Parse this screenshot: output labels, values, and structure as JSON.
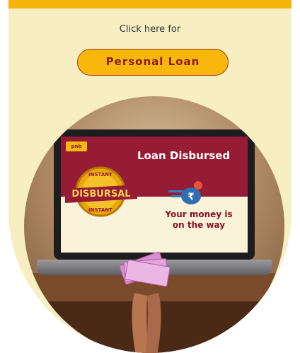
{
  "header": {
    "prompt": "Click here for"
  },
  "cta": {
    "label": "Personal Loan"
  },
  "banner": {
    "brand_badge": "pnb",
    "title": "Loan Disbursed",
    "subtitle_line1": "Your money is",
    "subtitle_line2": "on the way",
    "seal_top": "INSTANT",
    "seal_middle": "DISBURSAL",
    "seal_bottom": "INSTANT",
    "currency_symbol": "₹"
  },
  "colors": {
    "accent": "#f5b40a",
    "panel_background": "#f7efc2",
    "brand_maroon": "#961b35"
  },
  "icons": [
    "rupee-money-bag-icon",
    "disbursal-seal-icon"
  ]
}
